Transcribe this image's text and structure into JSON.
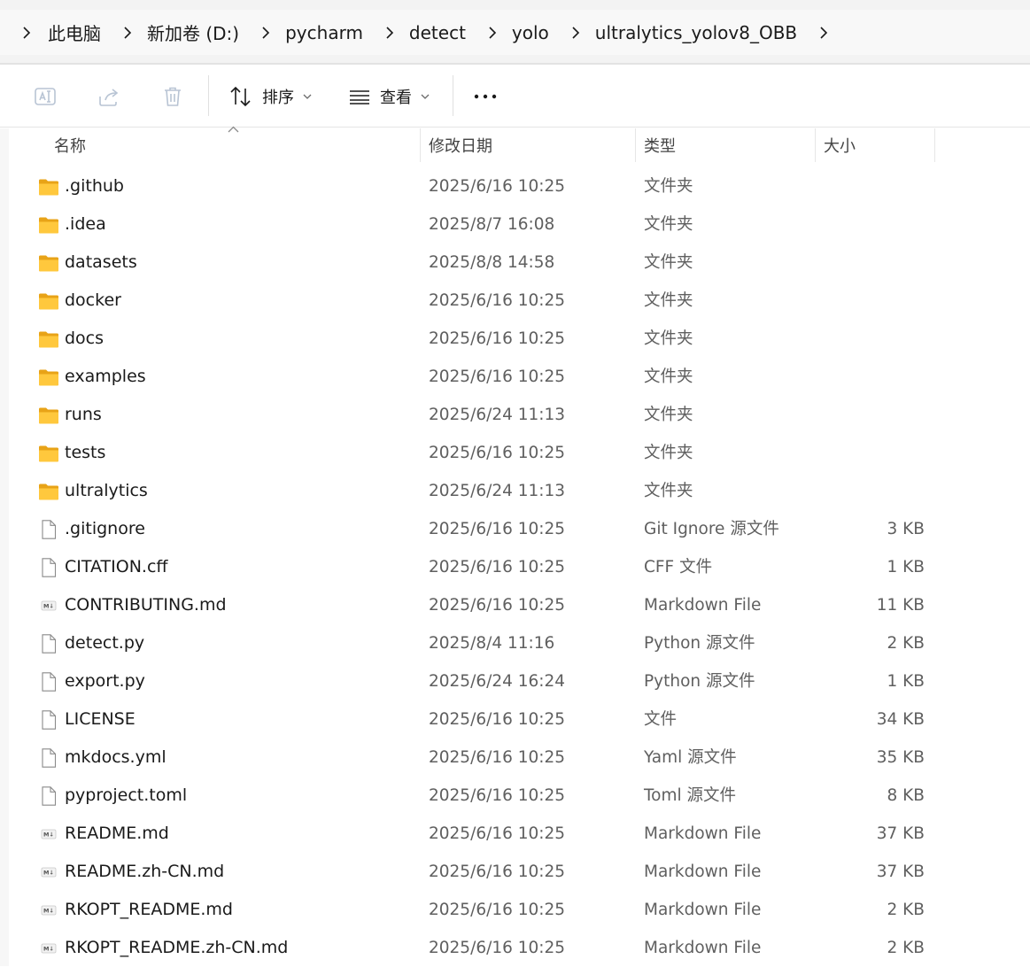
{
  "breadcrumb": {
    "items": [
      "此电脑",
      "新加卷 (D:)",
      "pycharm",
      "detect",
      "yolo",
      "ultralytics_yolov8_OBB"
    ]
  },
  "toolbar": {
    "sort_label": "排序",
    "view_label": "查看",
    "more_label": "•••"
  },
  "columns": {
    "name": "名称",
    "date": "修改日期",
    "type": "类型",
    "size": "大小"
  },
  "colors": {
    "folder": "#FFC83D",
    "folder_dark": "#E8A317",
    "text": "#1a1a1a",
    "muted": "#5f5f5f"
  },
  "files": [
    {
      "name": ".github",
      "date": "2025/6/16 10:25",
      "type": "文件夹",
      "size": "",
      "icon": "folder-icon"
    },
    {
      "name": ".idea",
      "date": "2025/8/7 16:08",
      "type": "文件夹",
      "size": "",
      "icon": "folder-icon"
    },
    {
      "name": "datasets",
      "date": "2025/8/8 14:58",
      "type": "文件夹",
      "size": "",
      "icon": "folder-icon"
    },
    {
      "name": "docker",
      "date": "2025/6/16 10:25",
      "type": "文件夹",
      "size": "",
      "icon": "folder-icon"
    },
    {
      "name": "docs",
      "date": "2025/6/16 10:25",
      "type": "文件夹",
      "size": "",
      "icon": "folder-icon"
    },
    {
      "name": "examples",
      "date": "2025/6/16 10:25",
      "type": "文件夹",
      "size": "",
      "icon": "folder-icon"
    },
    {
      "name": "runs",
      "date": "2025/6/24 11:13",
      "type": "文件夹",
      "size": "",
      "icon": "folder-icon"
    },
    {
      "name": "tests",
      "date": "2025/6/16 10:25",
      "type": "文件夹",
      "size": "",
      "icon": "folder-icon"
    },
    {
      "name": "ultralytics",
      "date": "2025/6/24 11:13",
      "type": "文件夹",
      "size": "",
      "icon": "folder-icon"
    },
    {
      "name": ".gitignore",
      "date": "2025/6/16 10:25",
      "type": "Git Ignore 源文件",
      "size": "3 KB",
      "icon": "file-icon"
    },
    {
      "name": "CITATION.cff",
      "date": "2025/6/16 10:25",
      "type": "CFF 文件",
      "size": "1 KB",
      "icon": "file-icon"
    },
    {
      "name": "CONTRIBUTING.md",
      "date": "2025/6/16 10:25",
      "type": "Markdown File",
      "size": "11 KB",
      "icon": "markdown-file-icon"
    },
    {
      "name": "detect.py",
      "date": "2025/8/4 11:16",
      "type": "Python 源文件",
      "size": "2 KB",
      "icon": "file-icon"
    },
    {
      "name": "export.py",
      "date": "2025/6/24 16:24",
      "type": "Python 源文件",
      "size": "1 KB",
      "icon": "file-icon"
    },
    {
      "name": "LICENSE",
      "date": "2025/6/16 10:25",
      "type": "文件",
      "size": "34 KB",
      "icon": "file-icon"
    },
    {
      "name": "mkdocs.yml",
      "date": "2025/6/16 10:25",
      "type": "Yaml 源文件",
      "size": "35 KB",
      "icon": "file-icon"
    },
    {
      "name": "pyproject.toml",
      "date": "2025/6/16 10:25",
      "type": "Toml 源文件",
      "size": "8 KB",
      "icon": "file-icon"
    },
    {
      "name": "README.md",
      "date": "2025/6/16 10:25",
      "type": "Markdown File",
      "size": "37 KB",
      "icon": "markdown-file-icon"
    },
    {
      "name": "README.zh-CN.md",
      "date": "2025/6/16 10:25",
      "type": "Markdown File",
      "size": "37 KB",
      "icon": "markdown-file-icon"
    },
    {
      "name": "RKOPT_README.md",
      "date": "2025/6/16 10:25",
      "type": "Markdown File",
      "size": "2 KB",
      "icon": "markdown-file-icon"
    },
    {
      "name": "RKOPT_README.zh-CN.md",
      "date": "2025/6/16 10:25",
      "type": "Markdown File",
      "size": "2 KB",
      "icon": "markdown-file-icon"
    }
  ]
}
